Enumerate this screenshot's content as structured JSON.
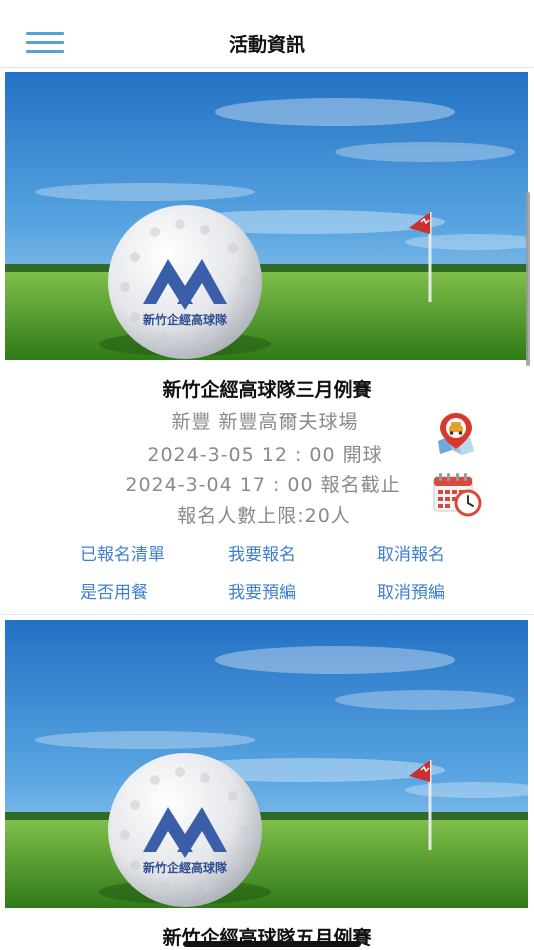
{
  "header": {
    "title": "活動資訊",
    "menu_icon": "hamburger-menu-icon"
  },
  "events": [
    {
      "banner_text": "新竹企經高球隊",
      "title": "新竹企經高球隊三月例賽",
      "venue": "新豐 新豐高爾夫球場",
      "tee_off": "2024-3-05 12 : 00 開球",
      "deadline": "2024-3-04  17 : 00 報名截止",
      "limit": "報名人數上限:20人",
      "map_icon": "map-location-icon",
      "calendar_icon": "calendar-clock-icon",
      "actions": {
        "registered_list": "已報名清單",
        "register": "我要報名",
        "cancel_register": "取消報名",
        "meal": "是否用餐",
        "pre_arrange": "我要預編",
        "cancel_pre_arrange": "取消預編"
      }
    },
    {
      "banner_text": "新竹企經高球隊",
      "title": "新竹企經高球隊五月例賽"
    }
  ],
  "colors": {
    "accent": "#3f7fd0",
    "menu": "#5aa0d6",
    "logo_blue": "#3a5fa8",
    "sky": "#2e7fd0",
    "grass": "#4f9a2e"
  }
}
